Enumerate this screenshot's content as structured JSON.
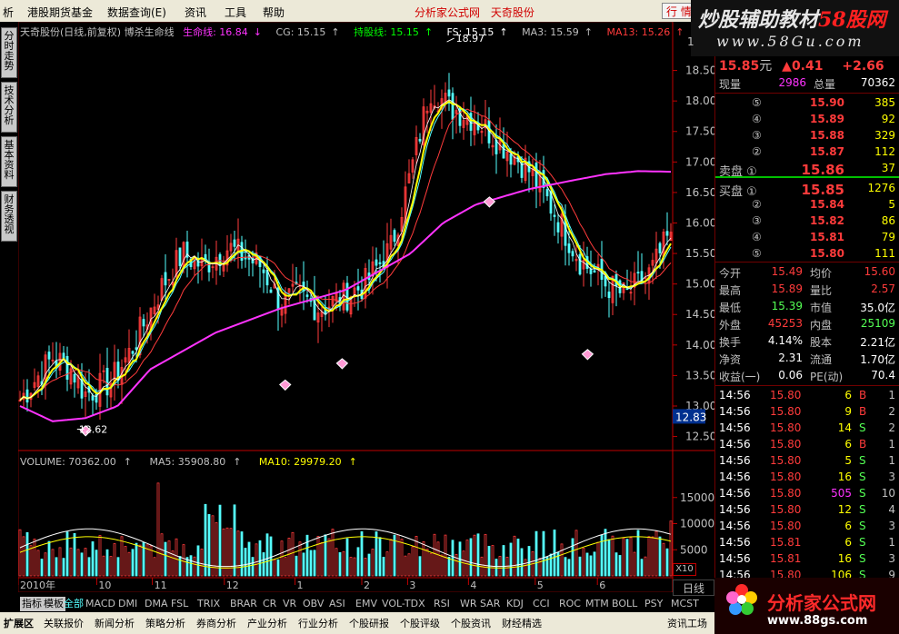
{
  "colors": {
    "up": "#ff3b3b",
    "down": "#54ffff",
    "flat": "#ffffff",
    "life": "#ff33ff",
    "cg": "#c0c0c0",
    "hold": "#ffff00",
    "ma3": "#ffffff",
    "ma13": "#ff3b3b",
    "yellow": "#ffff00"
  },
  "menu": {
    "items": [
      "析",
      "港股期货基金",
      "数据查询(E)",
      "资讯",
      "工具",
      "帮助"
    ],
    "center_links": [
      "分析家公式网",
      "天奇股份"
    ],
    "trade_button": "行 情"
  },
  "brand": {
    "title_main": "炒股辅助教材",
    "title_red": "58股网",
    "url": "www.58Gu.com"
  },
  "vtabs": [
    {
      "label": "分时走势"
    },
    {
      "label": "技术分析"
    },
    {
      "label": "基本资料"
    },
    {
      "label": "财务透视"
    }
  ],
  "legend": {
    "title": "天奇股份(日线,前复权) 博杀生命线",
    "life": "生命线: 16.84",
    "life_arrow": "↓",
    "cg": "CG: 15.15",
    "cg_arrow": "↑",
    "hold": "持股线: 15.15",
    "hold_arrow": "↑",
    "fs": "FS: 15.15",
    "fs_arrow": "↑",
    "ma3": "MA3: 15.59",
    "ma3_arrow": "↑",
    "ma13": "MA13: 15.26",
    "ma13_arrow": "↑"
  },
  "vol_legend": {
    "volume": "VOLUME: 70362.00",
    "volume_arrow": "↑",
    "ma5": "MA5: 35908.80",
    "ma5_arrow": "↑",
    "ma10": "MA10: 29979.20",
    "ma10_arrow": "↑"
  },
  "chart_data": {
    "type": "candlestick",
    "price_axis": {
      "min": 12.3,
      "max": 19.0,
      "ticks": [
        12.5,
        13.0,
        13.5,
        14.0,
        14.5,
        15.0,
        15.5,
        16.0,
        16.5,
        17.0,
        17.5,
        18.0,
        18.5
      ],
      "top_label": "1"
    },
    "price_axis_labels": [
      "12.50",
      "13.00",
      "13.50",
      "14.00",
      "14.50",
      "15.00",
      "15.50",
      "16.00",
      "16.50",
      "17.00",
      "17.50",
      "18.00",
      "18.50"
    ],
    "current_price_tag": "12.83",
    "high_mark": {
      "label": "18.97",
      "value": 18.97
    },
    "low_mark": {
      "label": "12.62",
      "value": 12.62
    },
    "volume_axis": {
      "min": 0,
      "max": 20000,
      "ticks": [
        5000,
        10000,
        15000
      ]
    },
    "volume_axis_labels": [
      "5000",
      "10000",
      "15000"
    ],
    "volume_unit_label": "X10",
    "time_labels": [
      {
        "label": "2010年",
        "pos": 0.0
      },
      {
        "label": "10",
        "pos": 0.12
      },
      {
        "label": "11",
        "pos": 0.205
      },
      {
        "label": "12",
        "pos": 0.315
      },
      {
        "label": "1",
        "pos": 0.423
      },
      {
        "label": "2",
        "pos": 0.525
      },
      {
        "label": "3",
        "pos": 0.595
      },
      {
        "label": "4",
        "pos": 0.688
      },
      {
        "label": "5",
        "pos": 0.79
      },
      {
        "label": "6",
        "pos": 0.885
      }
    ],
    "series_keyframes": {
      "close": [
        [
          0,
          13.1
        ],
        [
          0.05,
          13.8
        ],
        [
          0.08,
          13.6
        ],
        [
          0.1,
          13.2
        ],
        [
          0.14,
          13.4
        ],
        [
          0.17,
          13.9
        ],
        [
          0.22,
          15.0
        ],
        [
          0.25,
          15.5
        ],
        [
          0.28,
          15.3
        ],
        [
          0.32,
          15.6
        ],
        [
          0.37,
          15.3
        ],
        [
          0.4,
          14.7
        ],
        [
          0.43,
          14.8
        ],
        [
          0.46,
          14.6
        ],
        [
          0.5,
          14.8
        ],
        [
          0.53,
          15.0
        ],
        [
          0.57,
          15.6
        ],
        [
          0.6,
          16.8
        ],
        [
          0.63,
          18.2
        ],
        [
          0.66,
          17.9
        ],
        [
          0.7,
          17.7
        ],
        [
          0.74,
          17.3
        ],
        [
          0.78,
          16.9
        ],
        [
          0.82,
          16.2
        ],
        [
          0.86,
          15.4
        ],
        [
          0.9,
          15.0
        ],
        [
          0.93,
          14.8
        ],
        [
          0.97,
          15.2
        ],
        [
          1.0,
          15.85
        ]
      ],
      "life": [
        [
          0,
          13.0
        ],
        [
          0.05,
          12.75
        ],
        [
          0.1,
          12.8
        ],
        [
          0.15,
          13.0
        ],
        [
          0.2,
          13.6
        ],
        [
          0.3,
          14.2
        ],
        [
          0.4,
          14.6
        ],
        [
          0.5,
          14.9
        ],
        [
          0.6,
          15.5
        ],
        [
          0.65,
          16.0
        ],
        [
          0.7,
          16.3
        ],
        [
          0.78,
          16.55
        ],
        [
          0.85,
          16.7
        ],
        [
          0.9,
          16.8
        ],
        [
          0.95,
          16.85
        ],
        [
          1.0,
          16.84
        ]
      ]
    },
    "sell_signals": [
      0.103,
      0.408,
      0.495,
      0.72,
      0.87
    ],
    "sell_values": [
      12.75,
      13.5,
      13.85,
      16.5,
      14.0
    ]
  },
  "quote": {
    "price": "15.85",
    "price_unit": "元",
    "change": "▲0.41",
    "change_pct": "+2.66",
    "now_vol_label": "现量",
    "now_vol": "2986",
    "total_vol_label": "总量",
    "total_vol": "70362",
    "asks": [
      {
        "lvl": "⑤",
        "price": "15.90",
        "vol": "385"
      },
      {
        "lvl": "④",
        "price": "15.89",
        "vol": "92"
      },
      {
        "lvl": "③",
        "price": "15.88",
        "vol": "329"
      },
      {
        "lvl": "②",
        "price": "15.87",
        "vol": "112"
      },
      {
        "lvl": "卖盘 ①",
        "price": "15.86",
        "vol": "37"
      }
    ],
    "bids": [
      {
        "lvl": "买盘 ①",
        "price": "15.85",
        "vol": "1276"
      },
      {
        "lvl": "②",
        "price": "15.84",
        "vol": "5"
      },
      {
        "lvl": "③",
        "price": "15.82",
        "vol": "86"
      },
      {
        "lvl": "④",
        "price": "15.81",
        "vol": "79"
      },
      {
        "lvl": "⑤",
        "price": "15.80",
        "vol": "111"
      }
    ],
    "stats": [
      {
        "l1": "今开",
        "v1": "15.49",
        "c1": "#ff3b3b",
        "l2": "均价",
        "v2": "15.60",
        "c2": "#ff3b3b"
      },
      {
        "l1": "最高",
        "v1": "15.89",
        "c1": "#ff3b3b",
        "l2": "量比",
        "v2": "2.57",
        "c2": "#ff3b3b"
      },
      {
        "l1": "最低",
        "v1": "15.39",
        "c1": "#54ff54",
        "l2": "市值",
        "v2": "35.0亿",
        "c2": "#ffffff"
      },
      {
        "l1": "外盘",
        "v1": "45253",
        "c1": "#ff3b3b",
        "l2": "内盘",
        "v2": "25109",
        "c2": "#54ff54"
      },
      {
        "l1": "换手",
        "v1": "4.14%",
        "c1": "#ffffff",
        "l2": "股本",
        "v2": "2.21亿",
        "c2": "#ffffff"
      },
      {
        "l1": "净资",
        "v1": "2.31",
        "c1": "#ffffff",
        "l2": "流通",
        "v2": "1.70亿",
        "c2": "#ffffff"
      },
      {
        "l1": "收益(一)",
        "v1": "0.06",
        "c1": "#ffffff",
        "l2": "PE(动)",
        "v2": "70.4",
        "c2": "#ffffff"
      }
    ],
    "ticks": [
      {
        "t": "14:56",
        "p": "15.80",
        "v": "6",
        "s": "B",
        "n": "1"
      },
      {
        "t": "14:56",
        "p": "15.80",
        "v": "9",
        "s": "B",
        "n": "2"
      },
      {
        "t": "14:56",
        "p": "15.80",
        "v": "14",
        "s": "S",
        "n": "2"
      },
      {
        "t": "14:56",
        "p": "15.80",
        "v": "6",
        "s": "B",
        "n": "1"
      },
      {
        "t": "14:56",
        "p": "15.80",
        "v": "5",
        "s": "S",
        "n": "1"
      },
      {
        "t": "14:56",
        "p": "15.80",
        "v": "16",
        "s": "S",
        "n": "3"
      },
      {
        "t": "14:56",
        "p": "15.80",
        "v": "505",
        "s": "S",
        "n": "10"
      },
      {
        "t": "14:56",
        "p": "15.80",
        "v": "12",
        "s": "S",
        "n": "4"
      },
      {
        "t": "14:56",
        "p": "15.80",
        "v": "6",
        "s": "S",
        "n": "3"
      },
      {
        "t": "14:56",
        "p": "15.81",
        "v": "6",
        "s": "S",
        "n": "1"
      },
      {
        "t": "14:56",
        "p": "15.81",
        "v": "16",
        "s": "S",
        "n": "3"
      },
      {
        "t": "14:56",
        "p": "15.80",
        "v": "106",
        "s": "S",
        "n": "9"
      }
    ]
  },
  "indicator_tabs": [
    "指标",
    "模板",
    "全部",
    "MACD",
    "DMI",
    "DMA",
    "FSL",
    "TRIX",
    "BRAR",
    "CR",
    "VR",
    "OBV",
    "ASI",
    "EMV",
    "VOL-TDX",
    "RSI",
    "WR",
    "SAR",
    "KDJ",
    "CCI",
    "ROC",
    "MTM",
    "BOLL",
    "PSY",
    "MCST"
  ],
  "period_button": "日线",
  "status_tabs": [
    "扩展区",
    "关联报价",
    "新闻分析",
    "策略分析",
    "券商分析",
    "产业分析",
    "行业分析",
    "个股研报",
    "个股评级",
    "个股资讯",
    "财经精选"
  ],
  "status_right": "资讯工场",
  "logo": {
    "text": "分析家公式网",
    "url": "www.88gs.com"
  }
}
